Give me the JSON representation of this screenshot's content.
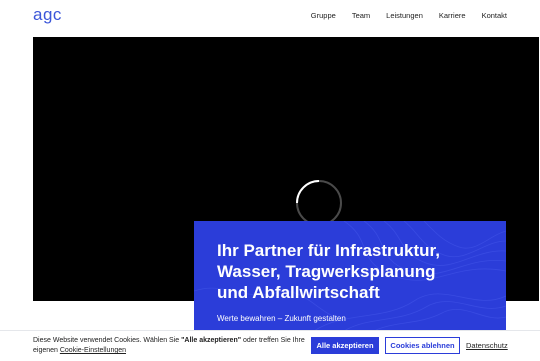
{
  "header": {
    "logo": "agc",
    "nav": [
      "Gruppe",
      "Team",
      "Leistungen",
      "Karriere",
      "Kontakt"
    ]
  },
  "hero": {
    "title_lines": [
      "Ihr Partner für Infrastruktur,",
      "Wasser, Tragwerksplanung",
      "und Abfallwirtschaft"
    ],
    "subtitle": "Werte bewahren – Zukunft gestalten"
  },
  "cookie": {
    "text_1": "Diese Website verwendet Cookies. Wählen Sie ",
    "text_bold": "\"Alle akzeptieren\"",
    "text_2": " oder treffen Sie Ihre eigenen ",
    "settings_link": "Cookie-Einstellungen",
    "accept_label": "Alle akzeptieren",
    "decline_label": "Cookies ablehnen",
    "privacy_label": "Datenschutz"
  },
  "colors": {
    "brand": "#2b3dd9",
    "video_bg": "#000000",
    "text": "#222222"
  },
  "icons": {
    "loading": "loading-spinner-icon"
  }
}
